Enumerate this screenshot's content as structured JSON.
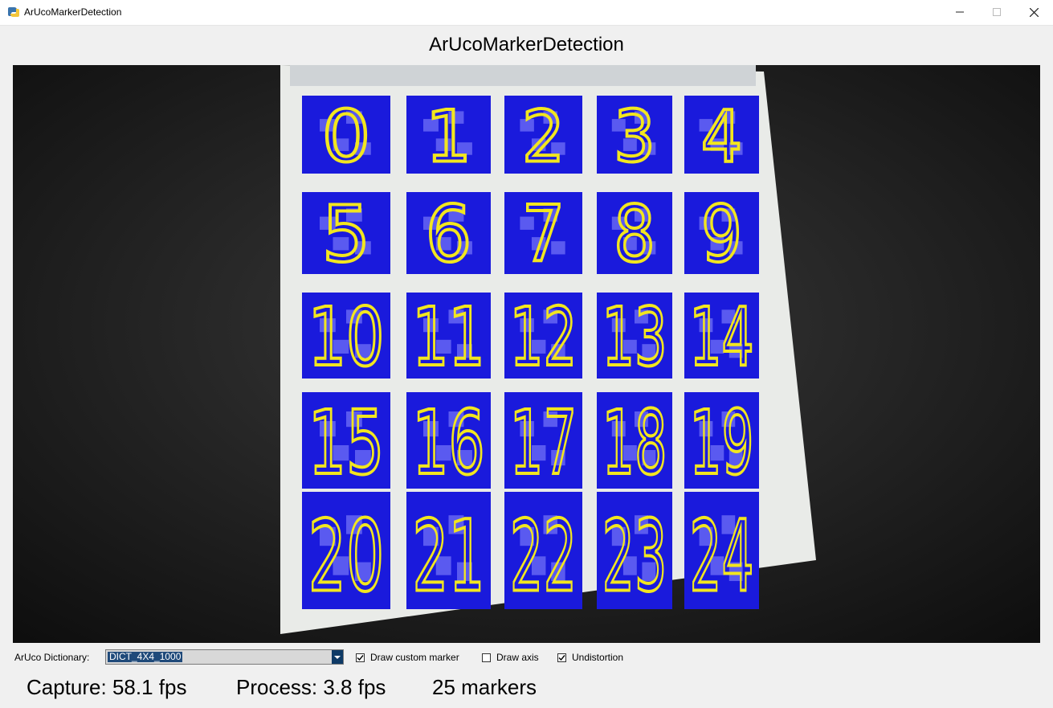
{
  "window": {
    "title": "ArUcoMarkerDetection",
    "icon": "python-icon",
    "buttons": {
      "minimize": "minimize-icon",
      "maximize": "maximize-icon",
      "close": "close-icon"
    }
  },
  "app_title": "ArUcoMarkerDetection",
  "video": {
    "marker_ids": [
      "0",
      "1",
      "2",
      "3",
      "4",
      "5",
      "6",
      "7",
      "8",
      "9",
      "10",
      "11",
      "12",
      "13",
      "14",
      "15",
      "16",
      "17",
      "18",
      "19",
      "20",
      "21",
      "22",
      "23",
      "24"
    ],
    "colors": {
      "marker_fill": "#1a1adc",
      "label_color": "#f2e61f",
      "board": "#e9ebe8",
      "background": "#151515"
    }
  },
  "controls": {
    "dictionary_label": "ArUco Dictionary:",
    "dictionary_value": "DICT_4X4_1000",
    "draw_custom_marker": {
      "label": "Draw custom marker",
      "checked": true
    },
    "draw_axis": {
      "label": "Draw axis",
      "checked": false
    },
    "undistortion": {
      "label": "Undistortion",
      "checked": true
    }
  },
  "status": {
    "capture": "Capture: 58.1 fps",
    "process": "Process: 3.8 fps",
    "markers": "25 markers"
  }
}
